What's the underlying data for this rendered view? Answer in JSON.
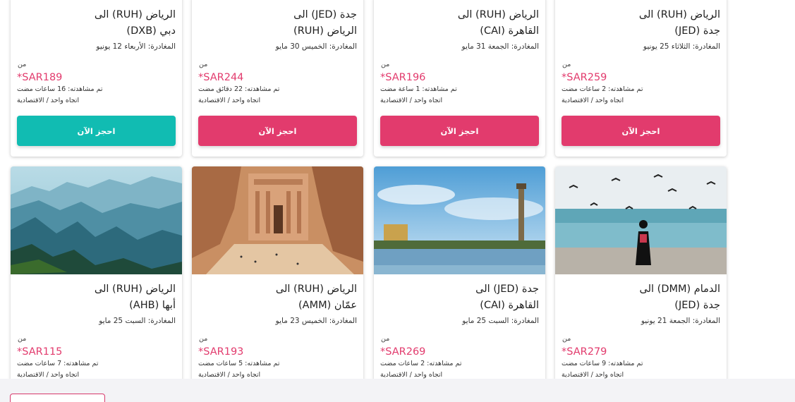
{
  "colors": {
    "accent": "#e23b6d",
    "teal": "#11bcb2",
    "button_pink": "#e23b6d"
  },
  "cards_row1": [
    {
      "title_line1": "الرياض (RUH) الى",
      "title_line2": "دبي (DXB)",
      "departure": "المغادرة: الأربعاء 12 يونيو",
      "from": "من",
      "price": "*SAR189",
      "viewed": "تم مشاهدته: 16 ساعات مضت",
      "trip": "اتجاه واحد / الاقتصادية",
      "button": "احجز الآن",
      "button_color": "#11bcb2"
    },
    {
      "title_line1": "جدة (JED) الى",
      "title_line2": "الرياض (RUH)",
      "departure": "المغادرة: الخميس 30 مايو",
      "from": "من",
      "price": "*SAR244",
      "viewed": "تم مشاهدته: 22 دقائق مضت",
      "trip": "اتجاه واحد / الاقتصادية",
      "button": "احجز الآن",
      "button_color": "#e23b6d"
    },
    {
      "title_line1": "الرياض (RUH) الى",
      "title_line2": "القاهرة (CAI)",
      "departure": "المغادرة: الجمعة 31 مايو",
      "from": "من",
      "price": "*SAR196",
      "viewed": "تم مشاهدته: 1 ساعة مضت",
      "trip": "اتجاه واحد / الاقتصادية",
      "button": "احجز الآن",
      "button_color": "#e23b6d"
    },
    {
      "title_line1": "الرياض (RUH) الى",
      "title_line2": "جدة (JED)",
      "departure": "المغادرة: الثلاثاء 25 يونيو",
      "from": "من",
      "price": "*SAR259",
      "viewed": "تم مشاهدته: 2 ساعات مضت",
      "trip": "اتجاه واحد / الاقتصادية",
      "button": "احجز الآن",
      "button_color": "#e23b6d"
    }
  ],
  "cards_row2": [
    {
      "image": "abha-mountains-photo",
      "title_line1": "الرياض (RUH) الى",
      "title_line2": "أبها (AHB)",
      "departure": "المغادرة: السبت 25 مايو",
      "from": "من",
      "price": "*SAR115",
      "viewed": "تم مشاهدته: 7 ساعات مضت",
      "trip": "اتجاه واحد / الاقتصادية"
    },
    {
      "image": "petra-treasury-photo",
      "title_line1": "الرياض (RUH) الى",
      "title_line2": "عمّان (AMM)",
      "departure": "المغادرة: الخميس 23 مايو",
      "from": "من",
      "price": "*SAR193",
      "viewed": "تم مشاهدته: 5 ساعات مضت",
      "trip": "اتجاه واحد / الاقتصادية"
    },
    {
      "image": "cairo-tower-nile-photo",
      "title_line1": "جدة (JED) الى",
      "title_line2": "القاهرة (CAI)",
      "departure": "المغادرة: السبت 25 مايو",
      "from": "من",
      "price": "*SAR269",
      "viewed": "تم مشاهدته: 2 ساعات مضت",
      "trip": "اتجاه واحد / الاقتصادية"
    },
    {
      "image": "dammam-seaside-birds-photo",
      "title_line1": "الدمام (DMM) الى",
      "title_line2": "جدة (JED)",
      "departure": "المغادرة: الجمعة 21 يونيو",
      "from": "من",
      "price": "*SAR279",
      "viewed": "تم مشاهدته: 9 ساعات مضت",
      "trip": "اتجاه واحد / الاقتصادية"
    }
  ]
}
